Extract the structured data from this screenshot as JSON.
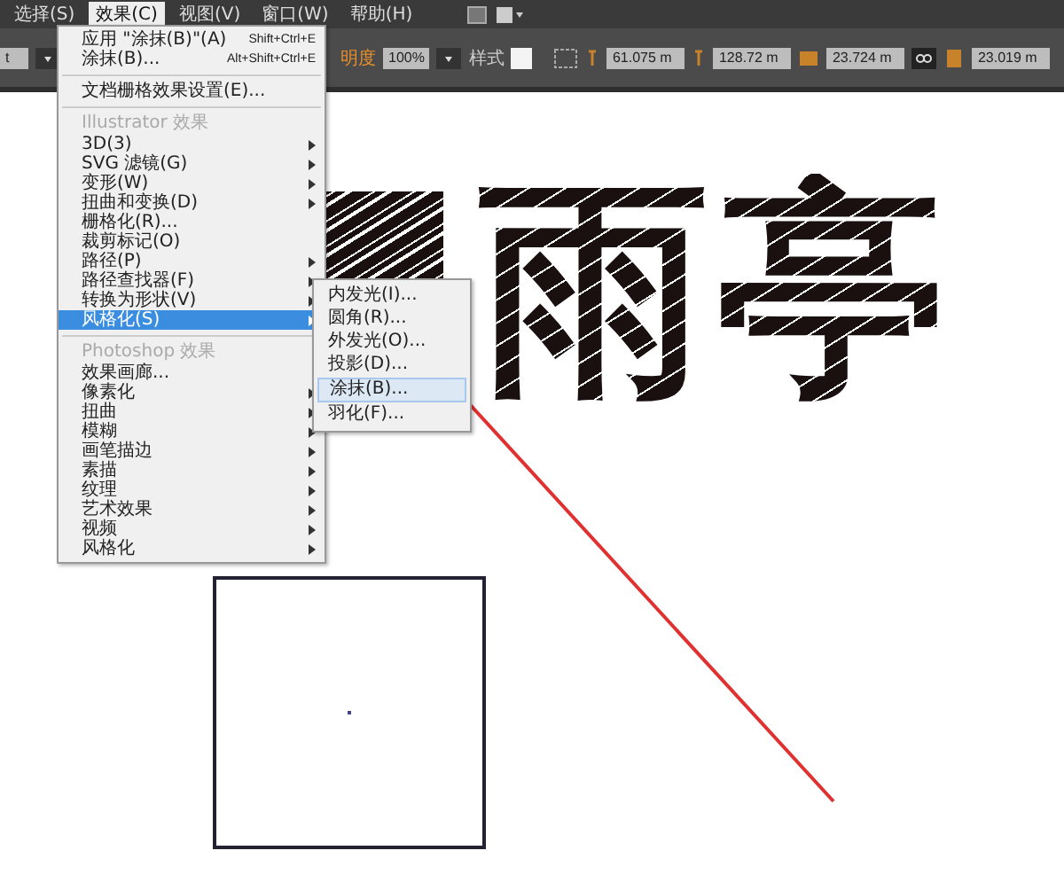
{
  "menubar": [
    {
      "label": "选择(S)",
      "selected": false
    },
    {
      "label": "效果(C)",
      "selected": true
    },
    {
      "label": "视图(V)",
      "selected": false
    },
    {
      "label": "窗口(W)",
      "selected": false
    },
    {
      "label": "帮助(H)",
      "selected": false
    }
  ],
  "control_bar": {
    "left_field": "t",
    "opacity_label": "明度",
    "opacity": "100%",
    "style_label": "样式",
    "x": "61.075 m",
    "y": "128.72 m",
    "w": "23.724 m",
    "h": "23.019 m"
  },
  "canvas_text": "雨亭",
  "effect_menu": [
    {
      "kind": "item",
      "label": "应用 \"涂抹(B)\"(A)",
      "shortcut": "Shift+Ctrl+E",
      "submenu": false,
      "selected": false
    },
    {
      "kind": "item",
      "label": "涂抹(B)...",
      "shortcut": "Alt+Shift+Ctrl+E",
      "submenu": false,
      "selected": false
    },
    {
      "kind": "separator"
    },
    {
      "kind": "item",
      "label": "文档栅格效果设置(E)...",
      "submenu": false,
      "selected": false
    },
    {
      "kind": "separator"
    },
    {
      "kind": "header",
      "label": "Illustrator 效果"
    },
    {
      "kind": "item",
      "label": "3D(3)",
      "submenu": true,
      "selected": false
    },
    {
      "kind": "item",
      "label": "SVG 滤镜(G)",
      "submenu": true,
      "selected": false
    },
    {
      "kind": "item",
      "label": "变形(W)",
      "submenu": true,
      "selected": false
    },
    {
      "kind": "item",
      "label": "扭曲和变换(D)",
      "submenu": true,
      "selected": false
    },
    {
      "kind": "item",
      "label": "栅格化(R)...",
      "submenu": false,
      "selected": false
    },
    {
      "kind": "item",
      "label": "裁剪标记(O)",
      "submenu": false,
      "selected": false
    },
    {
      "kind": "item",
      "label": "路径(P)",
      "submenu": true,
      "selected": false
    },
    {
      "kind": "item",
      "label": "路径查找器(F)",
      "submenu": true,
      "selected": false
    },
    {
      "kind": "item",
      "label": "转换为形状(V)",
      "submenu": true,
      "selected": false
    },
    {
      "kind": "item",
      "label": "风格化(S)",
      "submenu": true,
      "selected": true
    },
    {
      "kind": "separator"
    },
    {
      "kind": "header",
      "label": "Photoshop 效果"
    },
    {
      "kind": "item",
      "label": "效果画廊...",
      "submenu": false,
      "selected": false
    },
    {
      "kind": "item",
      "label": "像素化",
      "submenu": true,
      "selected": false
    },
    {
      "kind": "item",
      "label": "扭曲",
      "submenu": true,
      "selected": false
    },
    {
      "kind": "item",
      "label": "模糊",
      "submenu": true,
      "selected": false
    },
    {
      "kind": "item",
      "label": "画笔描边",
      "submenu": true,
      "selected": false
    },
    {
      "kind": "item",
      "label": "素描",
      "submenu": true,
      "selected": false
    },
    {
      "kind": "item",
      "label": "纹理",
      "submenu": true,
      "selected": false
    },
    {
      "kind": "item",
      "label": "艺术效果",
      "submenu": true,
      "selected": false
    },
    {
      "kind": "item",
      "label": "视频",
      "submenu": true,
      "selected": false
    },
    {
      "kind": "item",
      "label": "风格化",
      "submenu": true,
      "selected": false
    }
  ],
  "stylize_submenu": [
    {
      "label": "内发光(I)...",
      "selected": false
    },
    {
      "label": "圆角(R)...",
      "selected": false
    },
    {
      "label": "外发光(O)...",
      "selected": false
    },
    {
      "label": "投影(D)...",
      "selected": false
    },
    {
      "label": "涂抹(B)...",
      "selected": true
    },
    {
      "label": "羽化(F)...",
      "selected": false
    }
  ]
}
